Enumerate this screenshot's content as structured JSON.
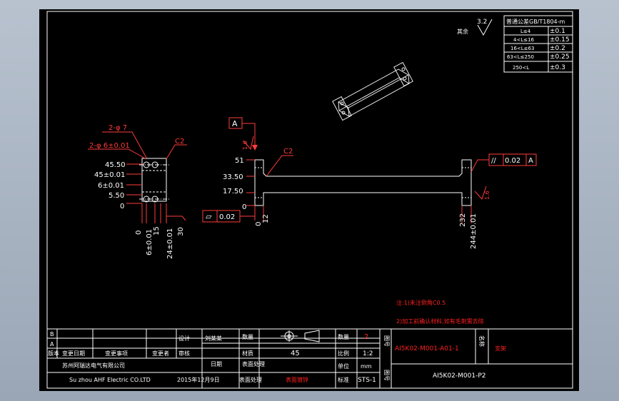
{
  "colors": {
    "background": "#000000",
    "frame": "#ffffff",
    "red_text": "#ff2020",
    "annotation": "#ff3b3b"
  },
  "roughness": {
    "symbol": "3.2",
    "label": "其余"
  },
  "tolerance_table": {
    "title": "普通公差GB/T1804-m",
    "rows": [
      {
        "label": "L≤4",
        "value": "±0.1"
      },
      {
        "label": "4<L≤16",
        "value": "±0.15"
      },
      {
        "label": "16<L≤63",
        "value": "±0.2"
      },
      {
        "label": "63<L≤250",
        "value": "±0.25"
      },
      {
        "label": "250<L",
        "value": "±0.3"
      }
    ]
  },
  "left_view": {
    "holes_2": "2-φ 7",
    "holes_1": "2-φ 6±0.01",
    "chamfer": "C2",
    "dims_left": [
      "45.50",
      "45±0.01",
      "6±0.01",
      "5.50",
      "0"
    ],
    "dims_bottom": [
      "0",
      "6±0.01",
      "15",
      "24±0.01",
      "30"
    ]
  },
  "main_view": {
    "datum": "A",
    "chamfer": "C2",
    "dims_left": [
      "51",
      "33.50",
      "17.50",
      "0"
    ],
    "dims_bottom_left": [
      "0",
      "12"
    ],
    "dims_bottom_right": [
      "232",
      "244±0.01"
    ],
    "flatness_symbol": "▱",
    "flatness_value": "0.02",
    "parallel_symbol": "//",
    "parallel_value": "0.02",
    "parallel_datum": "A",
    "rough_left": "1.6",
    "rough_right": "1.6"
  },
  "notes": {
    "line1": "注:1)未注倒角C0.5",
    "line2": "2)加工前确认材料,如有毛刺需去除"
  },
  "title_block": {
    "rev_rows": [
      "B",
      "A"
    ],
    "header_cols": [
      "版本",
      "变更日期",
      "变更事项",
      "变更者"
    ],
    "company_cn": "苏州阿瑞达电气有限公司",
    "company_en": "Su zhou AHF Electric CO.LTD",
    "design_label": "设计",
    "designer": "刘某某",
    "check_label": "审核",
    "date_label": "日期",
    "date": "2015年12月9日",
    "material_label": "材质",
    "material": "45",
    "surface_label": "表面处理",
    "projection_label": "视角",
    "unit_label": "单位",
    "unit": "mm",
    "qty_label": "数量",
    "qty": "2",
    "scale_label": "比例",
    "scale": "1:2",
    "fig_label": "图号",
    "fig_no": "AI5K02-M001-A01-1",
    "name_label": "名称",
    "name": "支架",
    "sheet_label": "图号",
    "sheet_no": "AI5K02-M001-P2",
    "std_label": "标准",
    "std": "STS-1",
    "finish_label": "表面处理",
    "finish": "表面镀锌",
    "process_label": "处理"
  }
}
